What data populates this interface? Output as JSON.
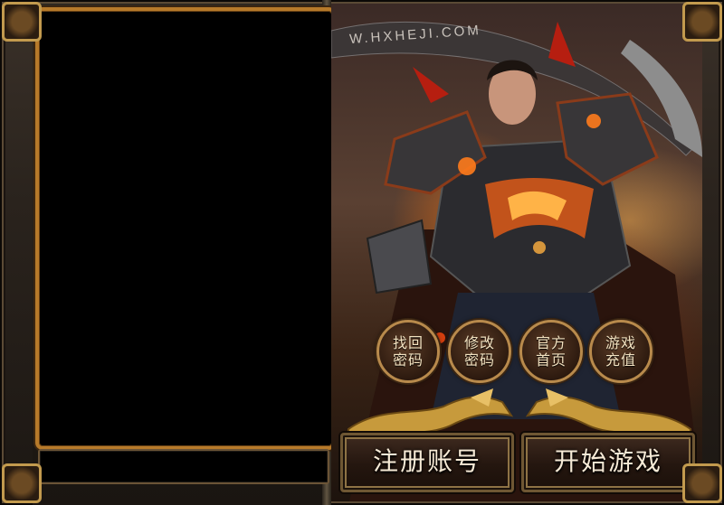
{
  "watermark": "W.HXHEJI.COM",
  "round_buttons": [
    {
      "label": "找回\n密码"
    },
    {
      "label": "修改\n密码"
    },
    {
      "label": "官方\n首页"
    },
    {
      "label": "游戏\n充值"
    }
  ],
  "big_buttons": {
    "register_label": "注册账号",
    "start_label": "开始游戏"
  },
  "colors": {
    "frame_gold": "#b77a2a",
    "button_text": "#f6ead6"
  }
}
